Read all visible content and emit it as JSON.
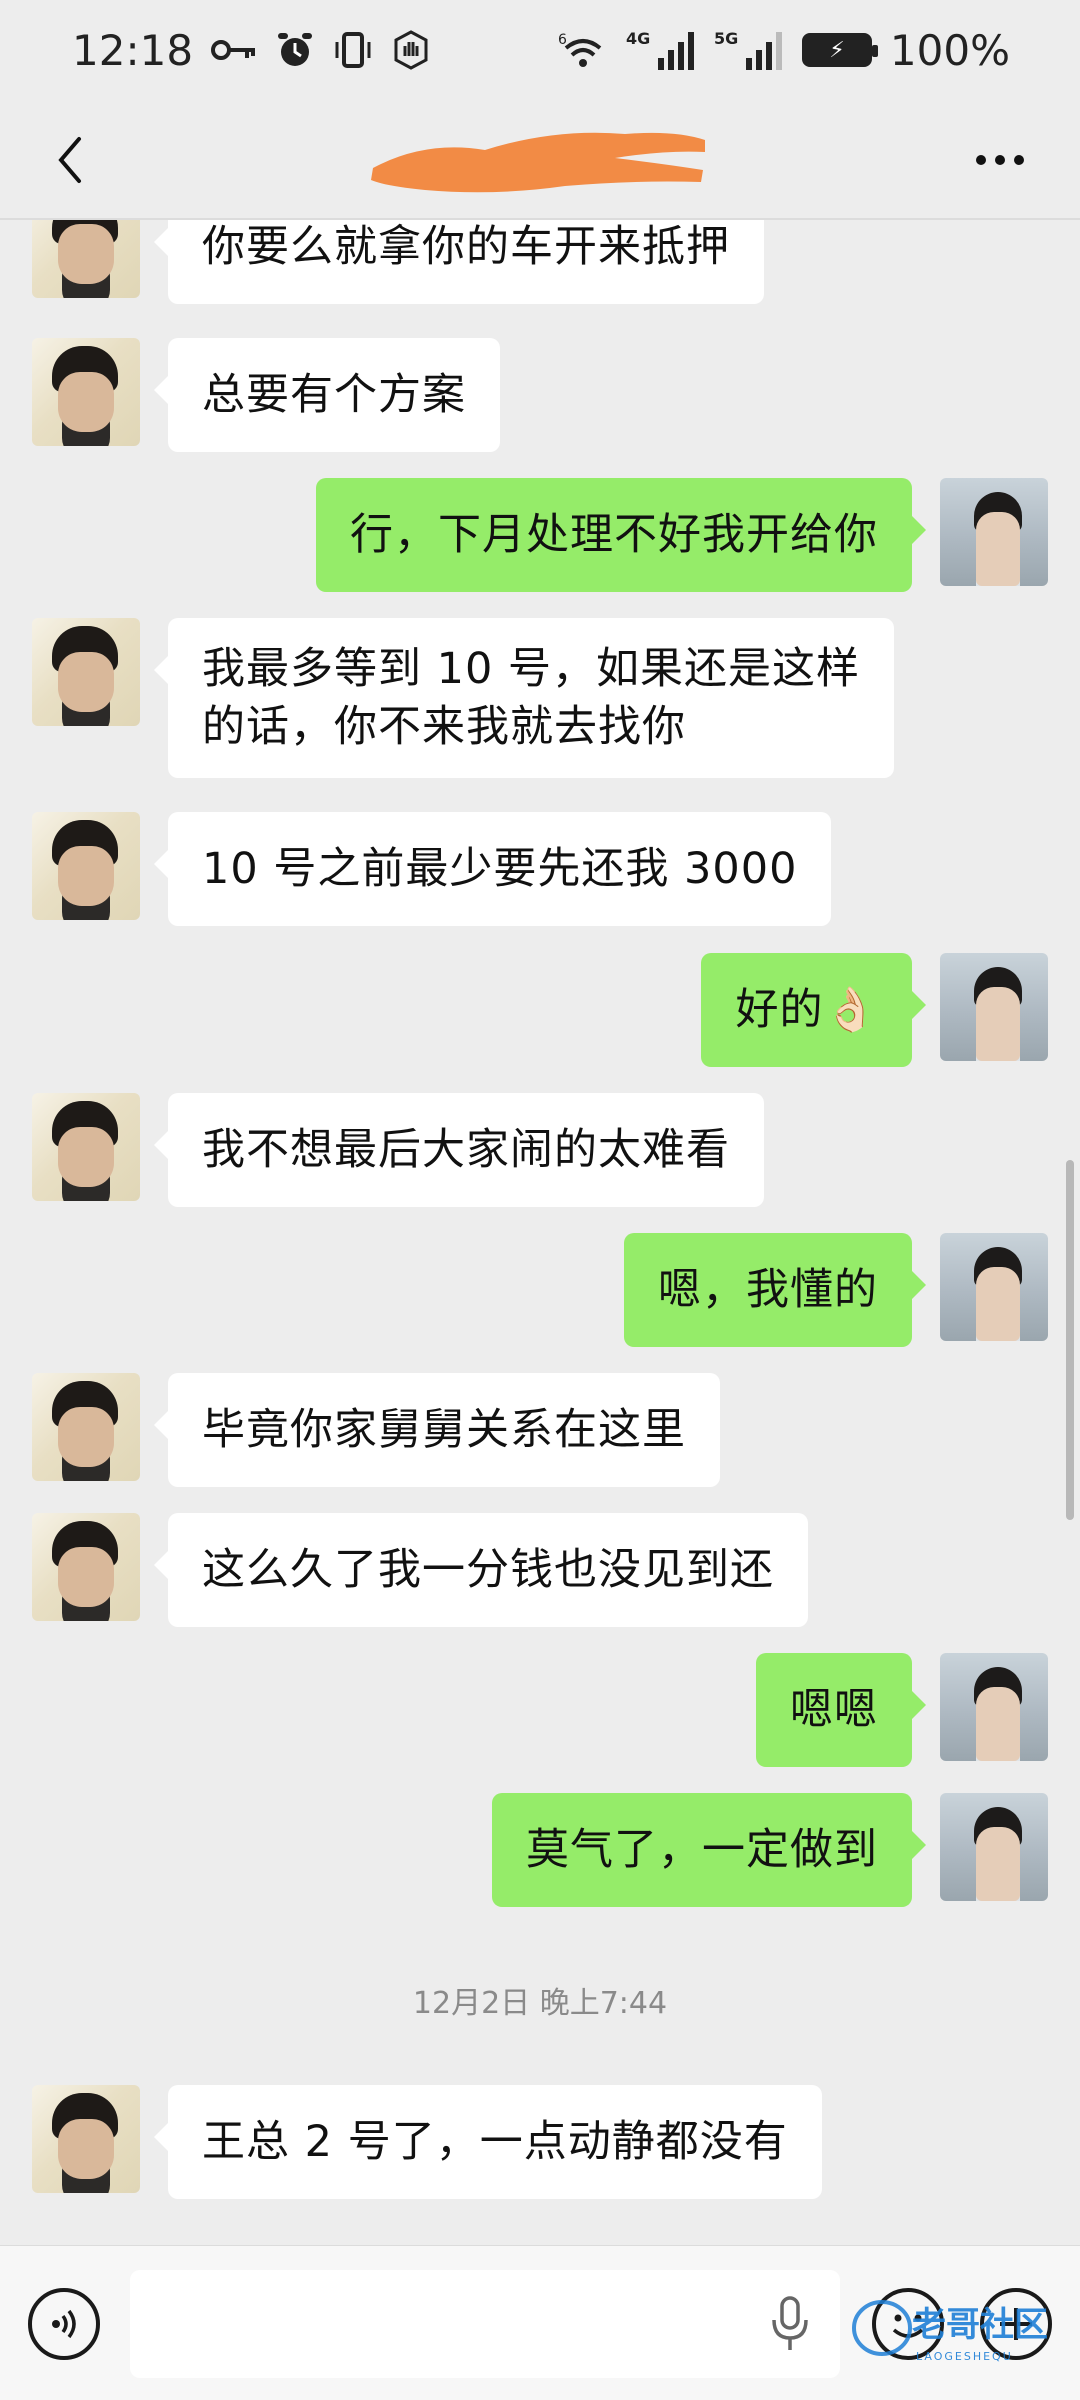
{
  "status_bar": {
    "time": "12:18",
    "network_4g": "4G",
    "network_5g": "5G",
    "wifi_badge": "6",
    "battery_percent": "100%"
  },
  "header": {
    "title": ""
  },
  "messages": [
    {
      "side": "left",
      "text": "你要么就拿你的车开来抵押"
    },
    {
      "side": "left",
      "text": "总要有个方案"
    },
    {
      "side": "right",
      "text": "行，下月处理不好我开给你"
    },
    {
      "side": "left",
      "text": "我最多等到 10 号，如果还是这样\n的话，你不来我就去找你"
    },
    {
      "side": "left",
      "text": "10 号之前最少要先还我 3000"
    },
    {
      "side": "right",
      "text": "好的👌🏻"
    },
    {
      "side": "left",
      "text": "我不想最后大家闹的太难看"
    },
    {
      "side": "right",
      "text": "嗯，我懂的"
    },
    {
      "side": "left",
      "text": "毕竟你家舅舅关系在这里"
    },
    {
      "side": "left",
      "text": "这么久了我一分钱也没见到还"
    },
    {
      "side": "right",
      "text": "嗯嗯"
    },
    {
      "side": "right",
      "text": "莫气了，一定做到"
    },
    {
      "side": "left",
      "text": "王总 2 号了，一点动静都没有"
    }
  ],
  "timestamp": "12月2日 晚上7:44",
  "input": {
    "placeholder": ""
  },
  "watermark": {
    "text": "老哥社区",
    "subtext": "LAOGESHEQU"
  },
  "colors": {
    "background": "#ededed",
    "self_bubble": "#95ec69",
    "other_bubble": "#ffffff",
    "redaction": "#f28b45"
  }
}
